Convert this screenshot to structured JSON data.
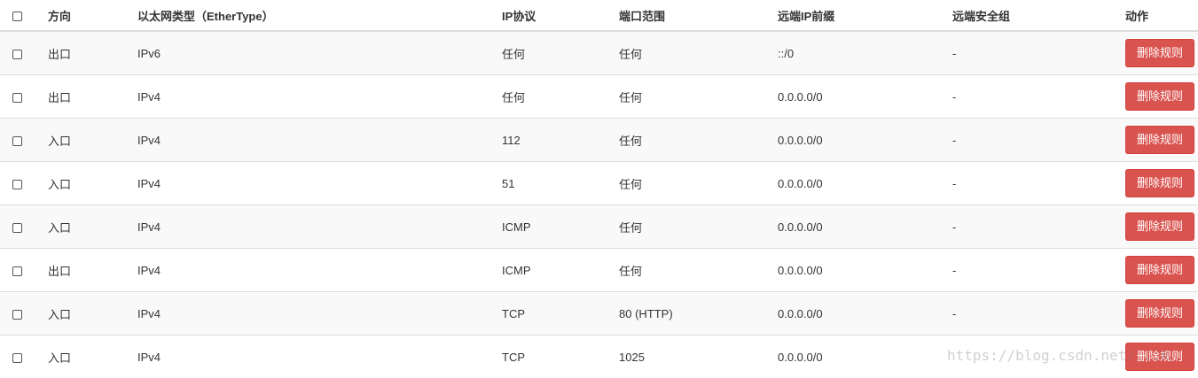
{
  "table": {
    "headers": {
      "direction": "方向",
      "ethertype": "以太网类型（EtherType）",
      "ip_protocol": "IP协议",
      "port_range": "端口范围",
      "remote_ip_prefix": "远端IP前缀",
      "remote_security_group": "远端安全组",
      "actions": "动作"
    },
    "rows": [
      {
        "direction": "出口",
        "ethertype": "IPv6",
        "ip_protocol": "任何",
        "port_range": "任何",
        "remote_ip_prefix": "::/0",
        "remote_security_group": "-",
        "action": "删除规则"
      },
      {
        "direction": "出口",
        "ethertype": "IPv4",
        "ip_protocol": "任何",
        "port_range": "任何",
        "remote_ip_prefix": "0.0.0.0/0",
        "remote_security_group": "-",
        "action": "删除规则"
      },
      {
        "direction": "入口",
        "ethertype": "IPv4",
        "ip_protocol": "112",
        "port_range": "任何",
        "remote_ip_prefix": "0.0.0.0/0",
        "remote_security_group": "-",
        "action": "删除规则"
      },
      {
        "direction": "入口",
        "ethertype": "IPv4",
        "ip_protocol": "51",
        "port_range": "任何",
        "remote_ip_prefix": "0.0.0.0/0",
        "remote_security_group": "-",
        "action": "删除规则"
      },
      {
        "direction": "入口",
        "ethertype": "IPv4",
        "ip_protocol": "ICMP",
        "port_range": "任何",
        "remote_ip_prefix": "0.0.0.0/0",
        "remote_security_group": "-",
        "action": "删除规则"
      },
      {
        "direction": "出口",
        "ethertype": "IPv4",
        "ip_protocol": "ICMP",
        "port_range": "任何",
        "remote_ip_prefix": "0.0.0.0/0",
        "remote_security_group": "-",
        "action": "删除规则"
      },
      {
        "direction": "入口",
        "ethertype": "IPv4",
        "ip_protocol": "TCP",
        "port_range": "80 (HTTP)",
        "remote_ip_prefix": "0.0.0.0/0",
        "remote_security_group": "-",
        "action": "删除规则"
      },
      {
        "direction": "入口",
        "ethertype": "IPv4",
        "ip_protocol": "TCP",
        "port_range": "1025",
        "remote_ip_prefix": "0.0.0.0/0",
        "remote_security_group": "",
        "action": "删除规则"
      }
    ]
  },
  "watermark": "https://blog.csdn.net/...k",
  "colors": {
    "danger": "#d9534f",
    "stripe": "#f9f9f9",
    "border": "#dddddd"
  }
}
